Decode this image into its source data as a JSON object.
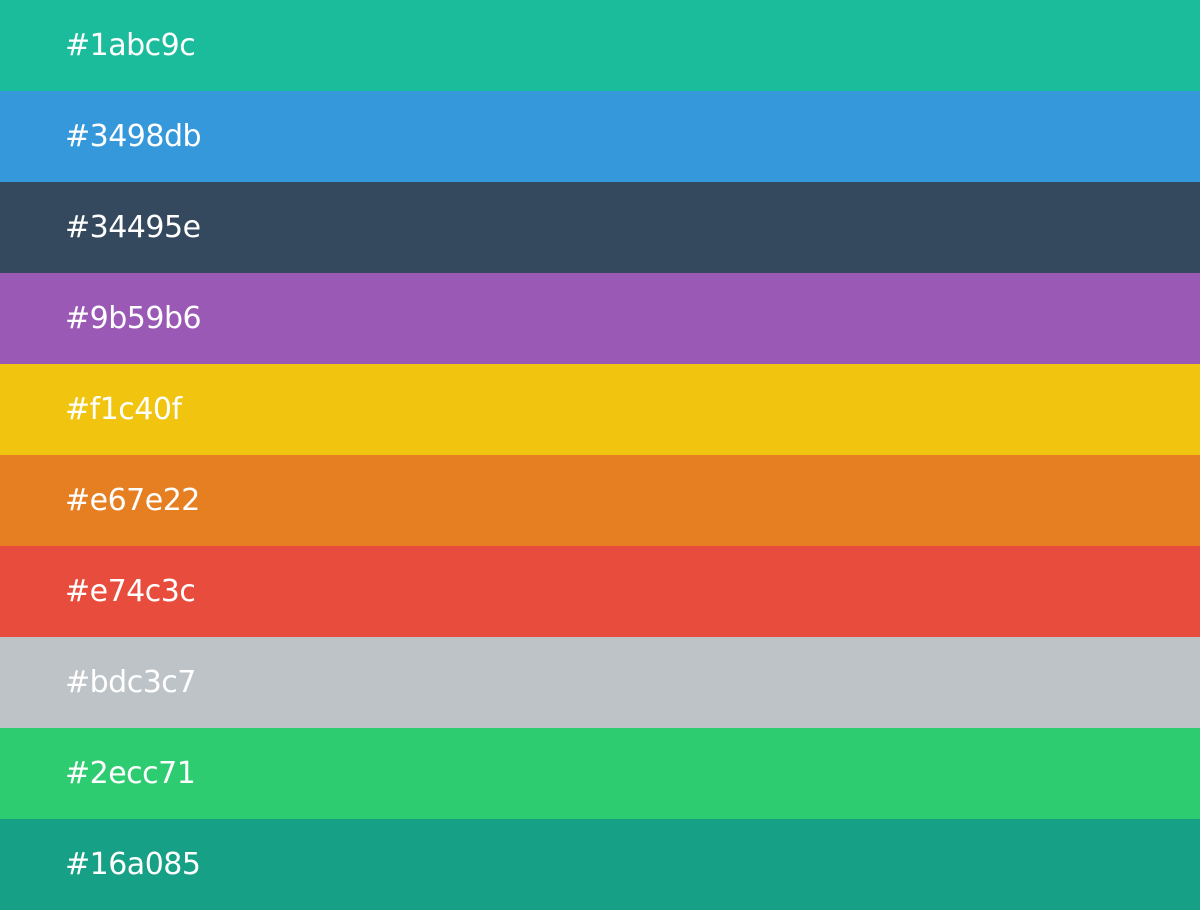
{
  "swatches": [
    {
      "label": "#1abc9c",
      "color": "#1abc9c"
    },
    {
      "label": "#3498db",
      "color": "#3498db"
    },
    {
      "label": "#34495e",
      "color": "#34495e"
    },
    {
      "label": "#9b59b6",
      "color": "#9b59b6"
    },
    {
      "label": "#f1c40f",
      "color": "#f1c40f"
    },
    {
      "label": "#e67e22",
      "color": "#e67e22"
    },
    {
      "label": "#e74c3c",
      "color": "#e74c3c"
    },
    {
      "label": "#bdc3c7",
      "color": "#bdc3c7"
    },
    {
      "label": "#2ecc71",
      "color": "#2ecc71"
    },
    {
      "label": "#16a085",
      "color": "#16a085"
    }
  ]
}
